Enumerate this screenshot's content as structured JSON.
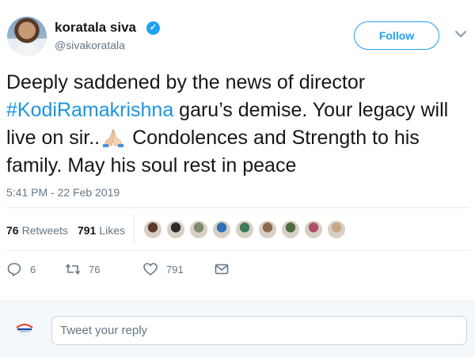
{
  "user": {
    "display_name": "koratala siva",
    "handle": "@sivakoratala",
    "verified": true
  },
  "follow_label": "Follow",
  "tweet": {
    "text_before_hashtag": "Deeply saddened by the news of director",
    "hashtag": "#KodiRamakrishna",
    "text_after_hashtag": "garu’s demise. Your legacy will live on sir..",
    "emoji": "folded-hands",
    "text_after_emoji": "Condolences and Strength to his family. May his soul rest in peace"
  },
  "timestamp": "5:41 PM - 22 Feb 2019",
  "stats": {
    "retweets_count": "76",
    "retweets_label": "Retweets",
    "likes_count": "791",
    "likes_label": "Likes"
  },
  "likers": [
    "#5b3a2a",
    "#2b2b2b",
    "#7a8b6e",
    "#2f6fb3",
    "#3d7a5a",
    "#8d6a4e",
    "#4e6d3f",
    "#b0506a",
    "#c9a88a"
  ],
  "actions": {
    "replies": "6",
    "retweets": "76",
    "likes": "791"
  },
  "reply_box": {
    "placeholder": "Tweet your reply"
  },
  "colors": {
    "accent": "#1da1f2",
    "hashtag": "#1b95e0",
    "secondary_text": "#657786"
  }
}
